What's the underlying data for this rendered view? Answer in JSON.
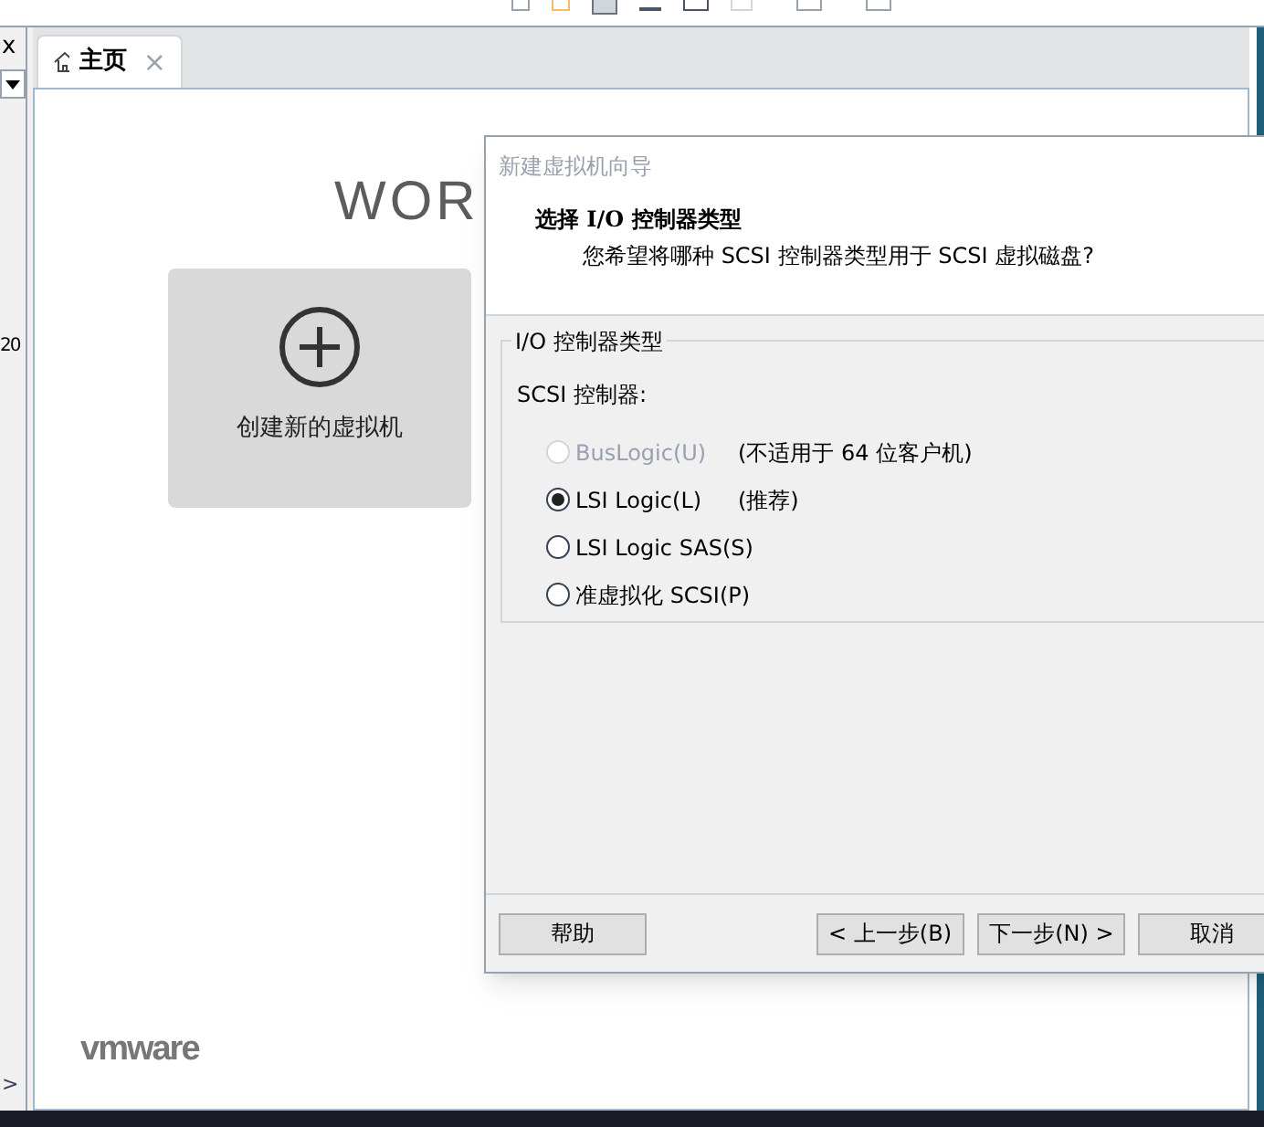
{
  "sidebar": {
    "close": "x",
    "number": "20",
    "expand": ">"
  },
  "tabs": [
    {
      "label": "主页",
      "selected": true,
      "close": "×"
    }
  ],
  "home": {
    "brand_title": "WOR",
    "tiles": [
      {
        "label": "创建新的虚拟机"
      }
    ],
    "footer_logo": "vmware"
  },
  "dialog": {
    "title": "新建虚拟机向导",
    "heading": "选择 I/O 控制器类型",
    "subheading": "您希望将哪种 SCSI 控制器类型用于 SCSI 虚拟磁盘?",
    "group": {
      "title": "I/O 控制器类型",
      "label": "SCSI 控制器:",
      "options": [
        {
          "label": "BusLogic(U)",
          "note": "(不适用于 64 位客户机)",
          "selected": false,
          "disabled": true
        },
        {
          "label": "LSI Logic(L)",
          "note": "(推荐)",
          "selected": true,
          "disabled": false
        },
        {
          "label": "LSI Logic SAS(S)",
          "selected": false,
          "disabled": false
        },
        {
          "label": "准虚拟化 SCSI(P)",
          "selected": false,
          "disabled": false
        }
      ]
    },
    "buttons": [
      {
        "label": "帮助",
        "kind": "left"
      },
      {
        "label": "< 上一步(B)",
        "kind": "right"
      },
      {
        "label": "下一步(N) >",
        "kind": "right"
      },
      {
        "label": "取消",
        "kind": "right"
      }
    ]
  }
}
